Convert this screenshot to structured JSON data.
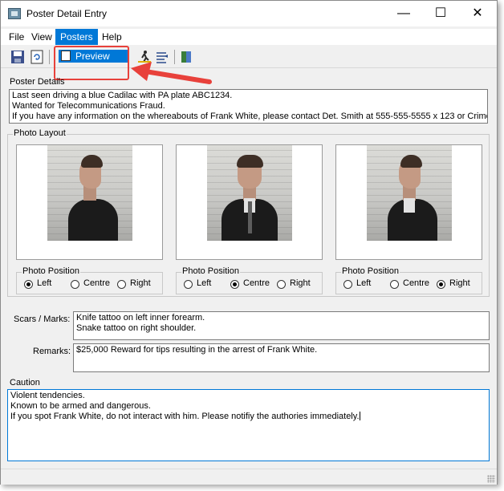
{
  "window": {
    "title": "Poster Detail Entry"
  },
  "menu": [
    "File",
    "View",
    "Posters",
    "Help"
  ],
  "toolbar": {
    "preview_label": "Preview"
  },
  "poster_details": {
    "label": "Poster Details",
    "lines": [
      "Last seen driving a blue Cadilac with PA plate ABC1234.",
      "Wanted for Telecommunications Fraud.",
      "If you have any information on the whereabouts of Frank White, please contact Det. Smith at 555-555-5555 x 123 or Crime"
    ]
  },
  "photo_layout": {
    "label": "Photo Layout",
    "position_label": "Photo Position",
    "options": [
      "Left",
      "Centre",
      "Right"
    ],
    "photos": [
      {
        "selected": "Left"
      },
      {
        "selected": "Centre"
      },
      {
        "selected": "Right"
      }
    ]
  },
  "scars_marks": {
    "label": "Scars / Marks:",
    "lines": [
      "Knife tattoo on left inner forearm.",
      "Snake tattoo on right shoulder."
    ]
  },
  "remarks": {
    "label": "Remarks:",
    "value": "$25,000 Reward for tips resulting in the arrest of Frank White."
  },
  "caution": {
    "label": "Caution",
    "lines": [
      "Violent tendencies.",
      "Known to be armed and dangerous.",
      "If you spot Frank White, do not interact with him.  Please notifiy the authories immediately."
    ]
  },
  "colors": {
    "accent": "#0078d7",
    "highlight": "#e8413b"
  }
}
